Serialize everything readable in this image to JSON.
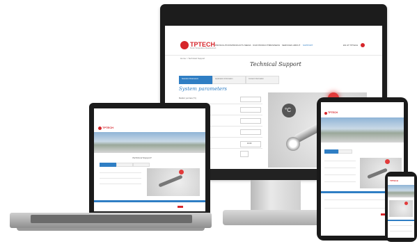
{
  "site": {
    "logo_text": "TPTECH",
    "logo_tagline": "Smart Temperature Measurement",
    "nav": [
      "PROSOLUTIONS",
      "PRODUCTS",
      "MEDIA",
      "OUR PRODUCTS",
      "BUSINESS",
      "SERVICES",
      "ABOUT",
      "SUPPORT"
    ],
    "nav_right": "EN AT TPTECH",
    "breadcrumb": "Home > Technical Support",
    "page_title": "Technical Support",
    "steps": [
      "Selection Parameters",
      "Application Information",
      "Contact Information"
    ],
    "section_title": "System parameters",
    "form_label": "Medium you have (°C)",
    "badge": "°C",
    "value_box": "10.00",
    "footer_button": "Send"
  },
  "colors": {
    "brand_red": "#d6262b",
    "accent_blue": "#2f7ec4",
    "bezel": "#1c1c1c"
  }
}
